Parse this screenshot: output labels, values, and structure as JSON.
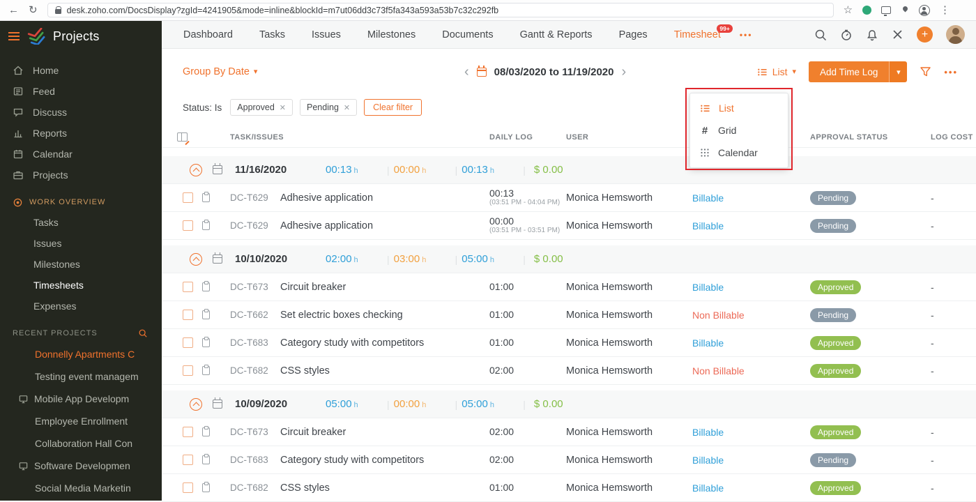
{
  "browser": {
    "url": "desk.zoho.com/DocsDisplay?zgId=4241905&mode=inline&blockId=m7ut06dd3c73f5fa343a593a53b7c32c292fb"
  },
  "sidebar": {
    "app_title": "Projects",
    "nav": [
      {
        "label": "Home"
      },
      {
        "label": "Feed"
      },
      {
        "label": "Discuss"
      },
      {
        "label": "Reports"
      },
      {
        "label": "Calendar"
      },
      {
        "label": "Projects"
      }
    ],
    "work_overview_label": "WORK OVERVIEW",
    "work_overview": [
      {
        "label": "Tasks"
      },
      {
        "label": "Issues"
      },
      {
        "label": "Milestones"
      },
      {
        "label": "Timesheets"
      },
      {
        "label": "Expenses"
      }
    ],
    "recent_label": "RECENT PROJECTS",
    "recent": [
      {
        "label": "Donnelly Apartments C"
      },
      {
        "label": "Testing event managem"
      },
      {
        "label": "Mobile App Developm"
      },
      {
        "label": "Employee Enrollment"
      },
      {
        "label": "Collaboration Hall Con"
      },
      {
        "label": "Software Developmen"
      },
      {
        "label": "Social Media Marketin"
      }
    ]
  },
  "topnav": {
    "tabs": [
      {
        "label": "Dashboard"
      },
      {
        "label": "Tasks"
      },
      {
        "label": "Issues"
      },
      {
        "label": "Milestones"
      },
      {
        "label": "Documents"
      },
      {
        "label": "Gantt & Reports"
      },
      {
        "label": "Pages"
      },
      {
        "label": "Timesheet",
        "badge": "99+"
      }
    ],
    "more": "•••"
  },
  "toolbar": {
    "group_by": "Group By Date",
    "date_range": "08/03/2020 to 11/19/2020",
    "view_label": "List",
    "add_button": "Add Time Log",
    "more": "•••"
  },
  "view_menu": {
    "items": [
      {
        "label": "List"
      },
      {
        "label": "Grid"
      },
      {
        "label": "Calendar"
      }
    ]
  },
  "filters": {
    "label": "Status: Is",
    "chips": [
      {
        "label": "Approved"
      },
      {
        "label": "Pending"
      }
    ],
    "clear": "Clear filter"
  },
  "units": {
    "hours": "h"
  },
  "table": {
    "headers": {
      "task": "TASK/ISSUES",
      "log": "DAILY LOG",
      "user": "USER",
      "approval": "APPROVAL STATUS",
      "cost": "LOG COST"
    },
    "groups": [
      {
        "date": "11/16/2020",
        "billable": "00:13",
        "nonbillable": "00:00",
        "total": "00:13",
        "cost": "$ 0.00",
        "rows": [
          {
            "id": "DC-T629",
            "task": "Adhesive application",
            "log": "00:13",
            "range": "(03:51 PM - 04:04 PM)",
            "user": "Monica Hemsworth",
            "billable": "Billable",
            "status": "Pending",
            "cost": "-"
          },
          {
            "id": "DC-T629",
            "task": "Adhesive application",
            "log": "00:00",
            "range": "(03:51 PM - 03:51 PM)",
            "user": "Monica Hemsworth",
            "billable": "Billable",
            "status": "Pending",
            "cost": "-"
          }
        ]
      },
      {
        "date": "10/10/2020",
        "billable": "02:00",
        "nonbillable": "03:00",
        "total": "05:00",
        "cost": "$ 0.00",
        "rows": [
          {
            "id": "DC-T673",
            "task": "Circuit breaker",
            "log": "01:00",
            "user": "Monica Hemsworth",
            "billable": "Billable",
            "status": "Approved",
            "cost": "-"
          },
          {
            "id": "DC-T662",
            "task": "Set electric boxes checking",
            "log": "01:00",
            "user": "Monica Hemsworth",
            "billable": "Non Billable",
            "status": "Pending",
            "cost": "-"
          },
          {
            "id": "DC-T683",
            "task": "Category study with competitors",
            "log": "01:00",
            "user": "Monica Hemsworth",
            "billable": "Billable",
            "status": "Approved",
            "cost": "-"
          },
          {
            "id": "DC-T682",
            "task": "CSS styles",
            "log": "02:00",
            "user": "Monica Hemsworth",
            "billable": "Non Billable",
            "status": "Approved",
            "cost": "-"
          }
        ]
      },
      {
        "date": "10/09/2020",
        "billable": "05:00",
        "nonbillable": "00:00",
        "total": "05:00",
        "cost": "$ 0.00",
        "rows": [
          {
            "id": "DC-T673",
            "task": "Circuit breaker",
            "log": "02:00",
            "user": "Monica Hemsworth",
            "billable": "Billable",
            "status": "Approved",
            "cost": "-"
          },
          {
            "id": "DC-T683",
            "task": "Category study with competitors",
            "log": "02:00",
            "user": "Monica Hemsworth",
            "billable": "Billable",
            "status": "Pending",
            "cost": "-"
          },
          {
            "id": "DC-T682",
            "task": "CSS styles",
            "log": "01:00",
            "user": "Monica Hemsworth",
            "billable": "Billable",
            "status": "Approved",
            "cost": "-"
          }
        ]
      }
    ]
  }
}
